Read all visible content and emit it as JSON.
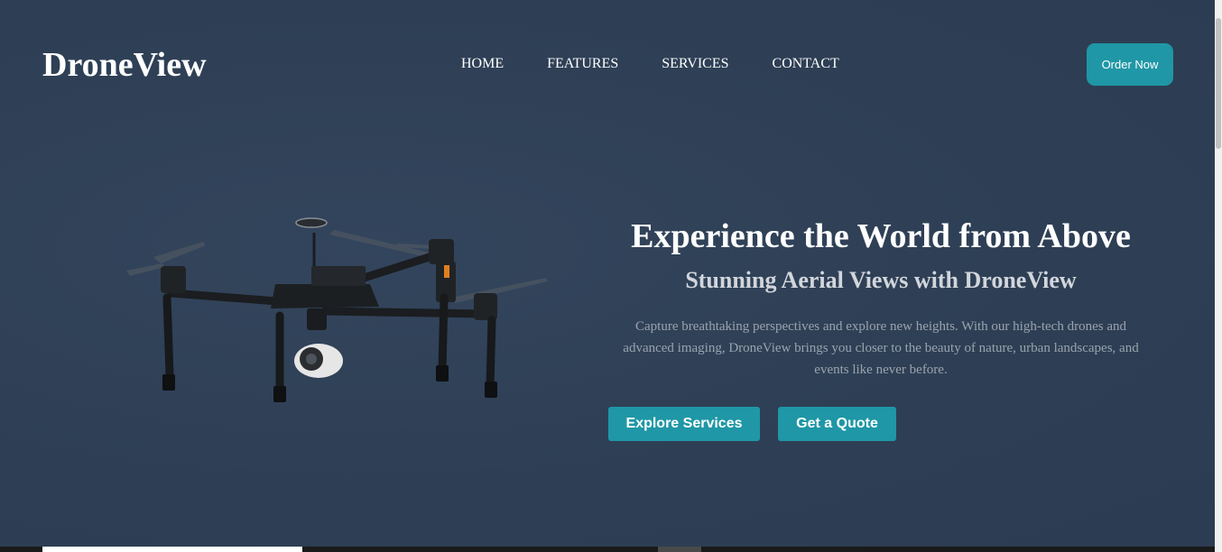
{
  "header": {
    "logo": "DroneView",
    "nav": [
      "HOME",
      "FEATURES",
      "SERVICES",
      "CONTACT"
    ],
    "order_label": "Order Now"
  },
  "hero": {
    "title": "Experience the World from Above",
    "subtitle": "Stunning Aerial Views with DroneView",
    "description": "Capture breathtaking perspectives and explore new heights. With our high-tech drones and advanced imaging, DroneView brings you closer to the beauty of nature, urban landscapes, and events like never before.",
    "explore_label": "Explore Services",
    "quote_label": "Get a Quote",
    "image_icon": "drone-image"
  },
  "colors": {
    "background": "#2e3f55",
    "accent": "#1f97a6",
    "text": "#ffffff",
    "muted": "#9aa3ae"
  }
}
